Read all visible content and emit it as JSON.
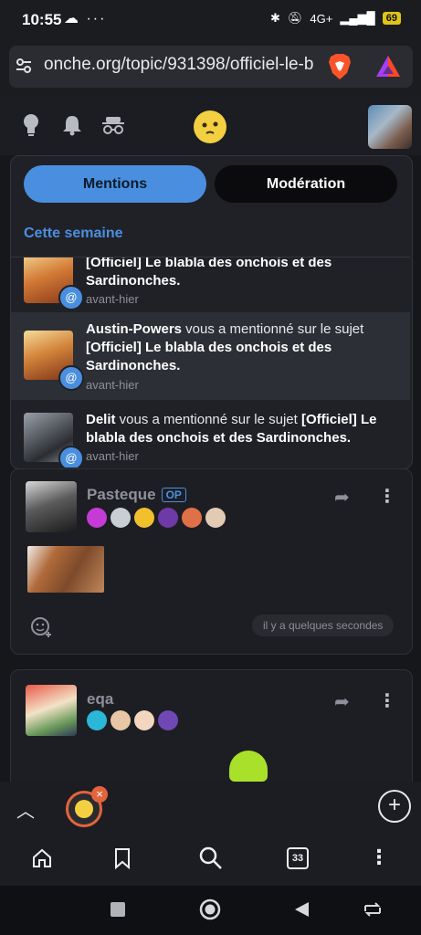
{
  "status_bar": {
    "time": "10:55",
    "left_icons": "☁ ···",
    "network": "4G+",
    "battery": "69"
  },
  "browser": {
    "url": "onche.org/topic/931398/officiel-le-b"
  },
  "header": {
    "icons": [
      "lightbulb-icon",
      "bell-icon",
      "incognito-icon"
    ]
  },
  "notifications": {
    "tabs": {
      "mentions": "Mentions",
      "moderation": "Modération"
    },
    "section": "Cette semaine",
    "items": [
      {
        "author": "",
        "text_plain": "",
        "topic": "[Officiel] Le blabla des onchois et des Sardinonches.",
        "time": "avant-hier"
      },
      {
        "author": "Austin-Powers",
        "text_plain": " vous a mentionné sur le sujet ",
        "topic": "[Officiel] Le blabla des onchois et des Sardinonches.",
        "time": "avant-hier"
      },
      {
        "author": "Delit",
        "text_plain": " vous a mentionné sur le sujet ",
        "topic": "[Officiel] Le blabla des onchois et des Sardinonches.",
        "time": "avant-hier"
      }
    ],
    "badge_symbol": "@"
  },
  "posts": [
    {
      "author": "Pasteque",
      "op": "OP",
      "timestamp": "il y a quelques secondes"
    },
    {
      "author": "eqa"
    }
  ],
  "bottom_toolbar": {
    "tab_count": "33"
  },
  "colors": {
    "accent": "#4a8fdf",
    "background": "#16171b",
    "panel": "#202127"
  }
}
